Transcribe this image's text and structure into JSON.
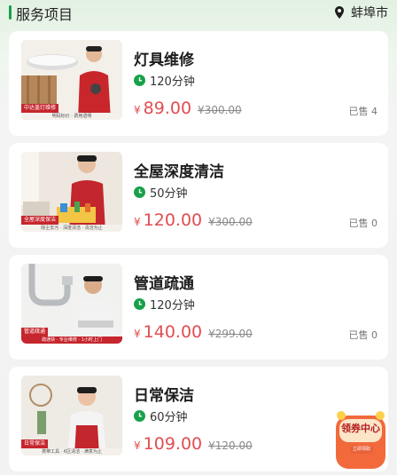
{
  "header": {
    "title": "服务项目",
    "location": "蚌埠市"
  },
  "services": [
    {
      "name": "灯具维修",
      "duration": "120分钟",
      "price": "89.00",
      "original_price": "300.00",
      "sold": "已售 4",
      "tag": "中达盖灯维修",
      "strip_text": "明码标价 · 费用透明"
    },
    {
      "name": "全屋深度清洁",
      "duration": "50分钟",
      "price": "120.00",
      "original_price": "300.00",
      "sold": "已售 0",
      "tag": "全屋深度保洁",
      "strip_text": "除尘去污 · 深度清洁 · 清洁为止"
    },
    {
      "name": "管道疏通",
      "duration": "120分钟",
      "price": "140.00",
      "original_price": "299.00",
      "sold": "已售 0",
      "tag": "管道疏通",
      "strip_text": "疏通快 · 专业维修 · 1小时上门"
    },
    {
      "name": "日常保洁",
      "duration": "60分钟",
      "price": "109.00",
      "original_price": "120.00",
      "sold": "",
      "tag": "日常保洁",
      "strip_text": "携带工具 · 6区清洁 · 满意为止"
    }
  ],
  "currency": "¥",
  "coupon": {
    "label": "领券中心",
    "button": "立即领取"
  },
  "colors": {
    "accent": "#19a14a",
    "price": "#e14d52",
    "tag": "#c6262d"
  }
}
